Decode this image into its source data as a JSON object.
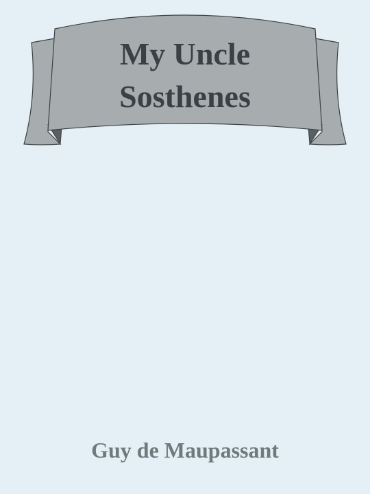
{
  "cover": {
    "title_line1": "My Uncle",
    "title_line2": "Sosthenes",
    "author": "Guy de Maupassant"
  },
  "colors": {
    "background": "#e4f0f5",
    "ribbon_fill": "#a7adae",
    "ribbon_shadow": "#5a5f61",
    "ribbon_stroke": "#3c4044",
    "title_text": "#3c4044",
    "author_text": "#6f7a7d"
  }
}
